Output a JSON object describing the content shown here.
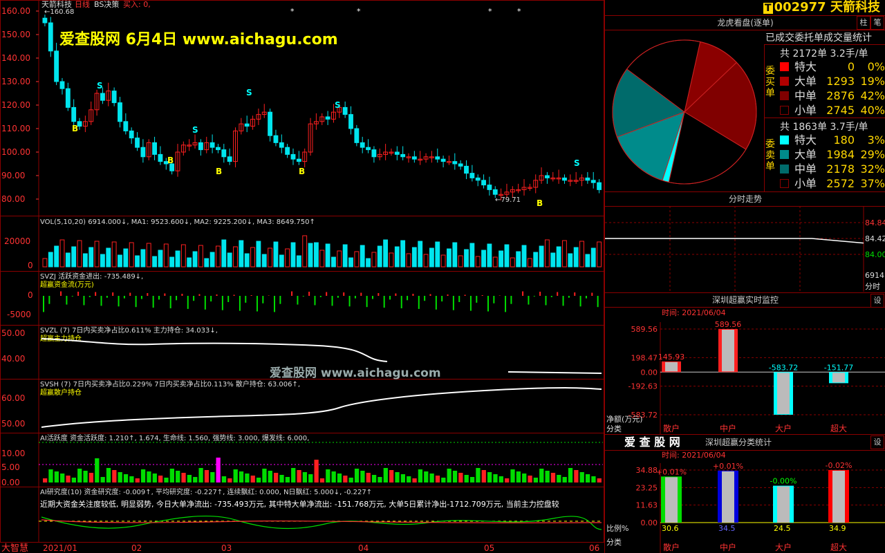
{
  "header": {
    "stock_name": "天箭科技",
    "period": "日线",
    "bs_label": "BS决策",
    "buy_label": "买入: 0,",
    "price_label": "160.68",
    "low_label": "79.71",
    "watermark": "爱查股网    6月4日    www.aichagu.com",
    "watermark_mid": "爱查股网  www.aichagu.com"
  },
  "price_axis": [
    "160.00",
    "150.00",
    "140.00",
    "130.00",
    "120.00",
    "110.00",
    "100.00",
    "90.00",
    "80.00"
  ],
  "signals": {
    "buy": "B",
    "sell": "S"
  },
  "panels": {
    "vol": {
      "text": "VOL(5,10,20) 6914.000↓, MA1: 9523.600↓, MA2: 9225.200↓, MA3: 8649.750↑",
      "axis": [
        "20000",
        "0"
      ]
    },
    "svzj": {
      "line1": "SVZJ  活跃资金进出: -735.489↓,",
      "line2": "超赢资金流(万元)",
      "axis": [
        "0",
        "-5000"
      ]
    },
    "svzl": {
      "line1": "SVZL (7) 7日内买卖净占比0.611% 主力持仓: 34.033↓,",
      "line2": "超赢主力持仓",
      "axis": [
        "50.00",
        "40.00"
      ]
    },
    "svsh": {
      "line1": "SVSH (7) 7日内买卖净占比0.229% 7日内买卖净占比0.113% 散户持仓: 63.006↑,",
      "line2": "超赢散户持仓",
      "axis": [
        "60.00",
        "50.00"
      ]
    },
    "ai": {
      "line1": "AI活跃度 资金活跃度: 1.210↑, 1.674, 生命线: 1.560, 强势线: 3.000, 爆发线: 6.000,",
      "axis": [
        "10.00",
        "5.00",
        "0.00"
      ]
    },
    "research": {
      "line1": "AI研究度(10) 资金研究度: -0.009↑, 平均研究度: -0.227↑, 连续飘红: 0.000, N日飘红: 5.000↓, -0.227↑",
      "line2": "近期大资金关注度较低, 明显弱势, 今日大单净流出: -735.493万元, 其中特大单净流出: -151.768万元, 大单5日累计净出-1712.709万元, 当前主力控盘较"
    }
  },
  "dates": [
    "2021/01",
    "02",
    "03",
    "04",
    "05",
    "06"
  ],
  "bottom_label": "大智慧",
  "side": {
    "code": "002977",
    "name": "天箭科技",
    "btn1": "柱",
    "btn2": "笔",
    "title1": "龙虎看盘(逐单)",
    "subtitle1": "已成交委托单成交量统计",
    "buy_group": {
      "label": "委买单",
      "summary": "共 2172单 3.2手/单",
      "rows": [
        {
          "name": "特大",
          "count": "0",
          "pct": "0%",
          "color": "#ff0000"
        },
        {
          "name": "大单",
          "count": "1293",
          "pct": "19%",
          "color": "#b00000"
        },
        {
          "name": "中单",
          "count": "2876",
          "pct": "42%",
          "color": "#800000"
        },
        {
          "name": "小单",
          "count": "2745",
          "pct": "40%",
          "color": "#000000"
        }
      ]
    },
    "sell_group": {
      "label": "委卖单",
      "summary": "共 1863单 3.7手/单",
      "rows": [
        {
          "name": "特大",
          "count": "180",
          "pct": "3%",
          "color": "#00ffff"
        },
        {
          "name": "大单",
          "count": "1984",
          "pct": "29%",
          "color": "#008b8b"
        },
        {
          "name": "中单",
          "count": "2178",
          "pct": "32%",
          "color": "#006b6b"
        },
        {
          "name": "小单",
          "count": "2572",
          "pct": "37%",
          "color": "#000000"
        }
      ]
    },
    "title2": "分时走势",
    "timeshare_axis": [
      "84.84",
      "84.42",
      "84.00",
      "6914",
      "分时"
    ],
    "title3": "深圳超赢实时监控",
    "set_label": "设",
    "time3": "时间: 2021/06/04",
    "axis3": [
      "589.56",
      "198.47",
      "0.00",
      "-192.63",
      "-583.72"
    ],
    "unit3": "净额(万元)",
    "cat_label": "分类",
    "categories": [
      "散户",
      "中户",
      "大户",
      "超大"
    ],
    "title4_brand": "爱 查 股 网",
    "title4": "深圳超赢分类统计",
    "time4": "时间: 2021/06/04",
    "axis4": [
      "34.88",
      "23.25",
      "11.63",
      "0.00"
    ],
    "unit4": "比例%"
  },
  "chart_data": [
    {
      "type": "pie",
      "title": "龙虎看盘(逐单)",
      "categories": [
        "委买特大",
        "委买大单",
        "委买中单",
        "委买小单",
        "委卖特大",
        "委卖大单",
        "委卖中单",
        "委卖小单"
      ],
      "values": [
        0,
        9.5,
        21,
        20,
        1.5,
        14.5,
        16,
        18.5
      ],
      "colors": [
        "#ff0000",
        "#8b0000",
        "#800000",
        "#000000",
        "#00ffff",
        "#008b8b",
        "#006b6b",
        "#000000"
      ]
    },
    {
      "type": "bar",
      "title": "深圳超赢实时监控",
      "categories": [
        "散户",
        "中户",
        "大户",
        "超大"
      ],
      "values": [
        145.93,
        589.56,
        -583.72,
        -151.77
      ],
      "labels": [
        "145.93",
        "589.56",
        "-583.72",
        "-151.77"
      ],
      "ylim": [
        -583.72,
        589.56
      ]
    },
    {
      "type": "bar",
      "title": "深圳超赢分类统计",
      "categories": [
        "散户",
        "中户",
        "大户",
        "超大"
      ],
      "values": [
        30.6,
        34.5,
        24.5,
        34.9
      ],
      "labels": [
        "30.6",
        "34.5",
        "24.5",
        "34.9"
      ],
      "change_labels": [
        "+0.01%",
        "+0.01%",
        "-0.00%",
        "-0.02%"
      ],
      "colors": [
        "#00dd00",
        "#0000dd",
        "#00ffff",
        "#ff0000"
      ],
      "ylim": [
        0,
        34.88
      ]
    },
    {
      "type": "line",
      "title": "分时走势",
      "x": [
        0,
        1,
        2,
        3,
        4,
        5
      ],
      "y": [
        84.42,
        84.42,
        84.42,
        84.42,
        84.42,
        84.3
      ],
      "ylim": [
        84.0,
        84.84
      ]
    }
  ]
}
